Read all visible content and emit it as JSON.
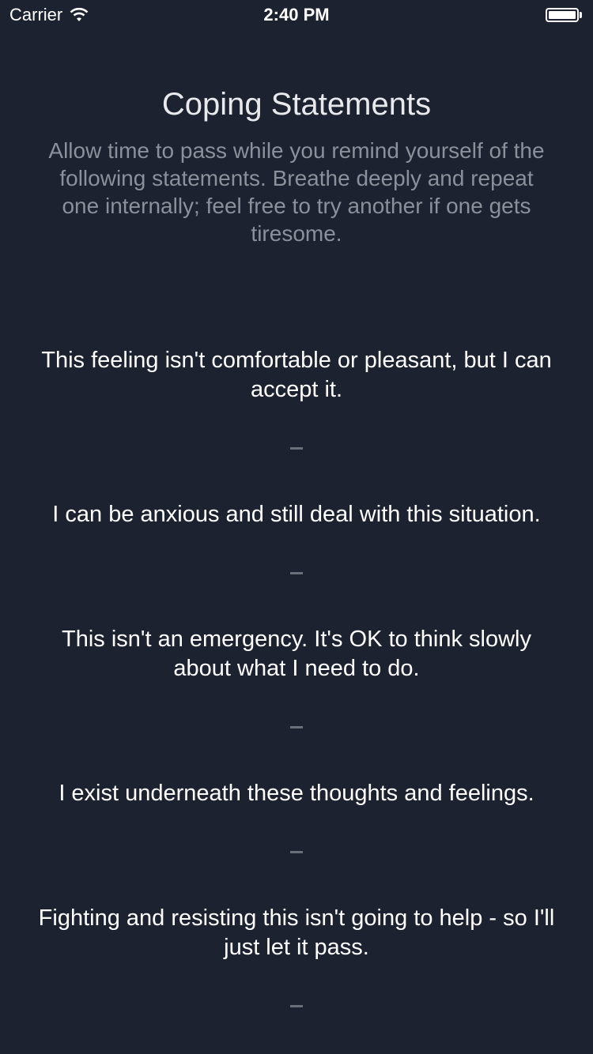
{
  "status_bar": {
    "carrier": "Carrier",
    "time": "2:40 PM",
    "wifi_icon": "wifi-icon",
    "battery_icon": "battery-icon",
    "battery_level": 1.0
  },
  "header": {
    "title": "Coping Statements",
    "subtitle": "Allow time to pass while you remind yourself of the following statements. Breathe deeply and repeat one internally; feel free to try another if one gets tiresome."
  },
  "statements": [
    "This feeling isn't comfortable or pleasant, but I can accept it.",
    "I can be anxious and still deal with this situation.",
    "This isn't an emergency. It's OK to think slowly about what I need to do.",
    "I exist underneath these thoughts and feelings.",
    "Fighting and resisting this isn't going to help - so I'll just let it pass."
  ],
  "colors": {
    "background": "#1d2230",
    "title": "#e8e9ec",
    "subtitle": "#8c909a",
    "divider": "#6b6f79"
  }
}
